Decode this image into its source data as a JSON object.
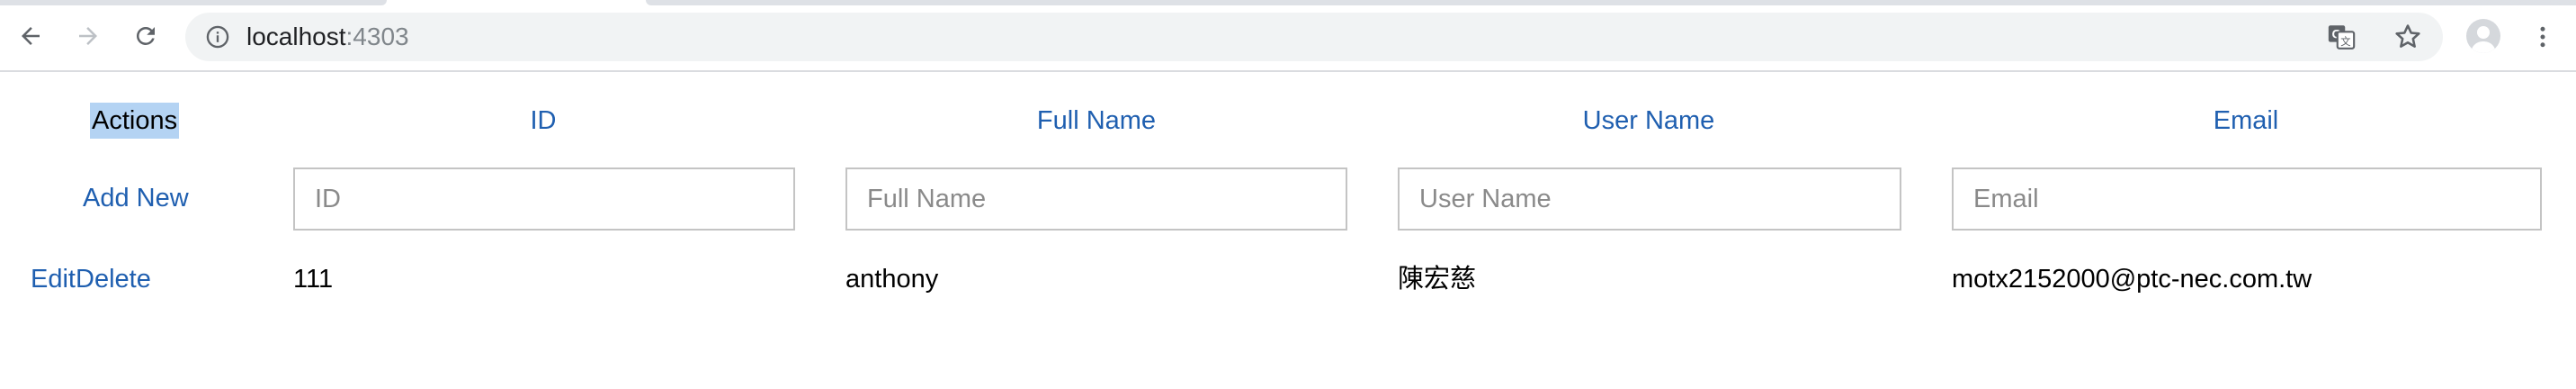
{
  "browser": {
    "url_host": "localhost",
    "url_port": ":4303",
    "icons": {
      "back": "arrow-left-icon",
      "forward": "arrow-right-icon",
      "reload": "reload-icon",
      "site_info": "info-icon",
      "translate": "translate-icon",
      "bookmark": "star-icon",
      "profile": "avatar",
      "menu": "kebab-menu-icon"
    }
  },
  "table": {
    "headers": {
      "actions": "Actions",
      "id": "ID",
      "full_name": "Full Name",
      "user_name": "User Name",
      "email": "Email"
    },
    "add_new_label": "Add New",
    "inputs": {
      "id": {
        "value": "",
        "placeholder": "ID"
      },
      "full_name": {
        "value": "",
        "placeholder": "Full Name"
      },
      "user_name": {
        "value": "",
        "placeholder": "User Name"
      },
      "email": {
        "value": "",
        "placeholder": "Email"
      }
    },
    "rows": [
      {
        "edit_label": "Edit",
        "delete_label": "Delete",
        "id": "111",
        "full_name": "anthony",
        "user_name": "陳宏慈",
        "email": "motx2152000@ptc-nec.com.tw"
      }
    ]
  },
  "colors": {
    "link": "#1f5fb0",
    "selection_highlight": "#b4d3f3",
    "omnibox_bg": "#f1f3f4",
    "input_border": "#c4c4c4"
  }
}
